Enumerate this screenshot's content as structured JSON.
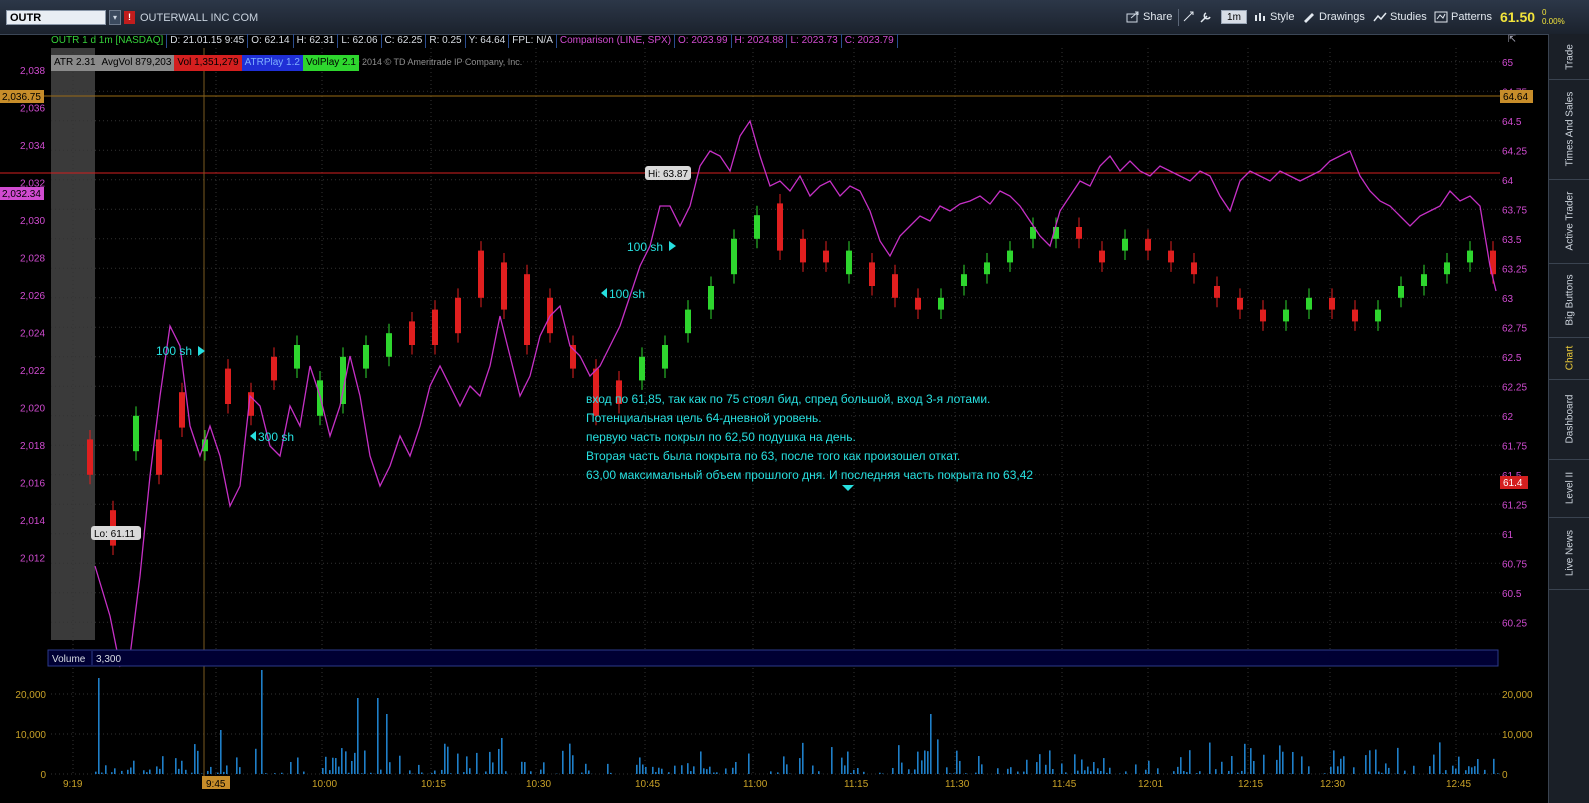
{
  "header": {
    "symbol": "OUTR",
    "company": "OUTERWALL INC COM",
    "flag": "!",
    "toolbar": [
      {
        "label": "Share",
        "icon": "share-icon"
      },
      {
        "label": "Style",
        "icon": "style-icon"
      },
      {
        "label": "Drawings",
        "icon": "drawings-icon"
      },
      {
        "label": "Studies",
        "icon": "studies-icon"
      },
      {
        "label": "Patterns",
        "icon": "patterns-icon"
      }
    ],
    "period": "1m",
    "last_price": "61.50",
    "change_top": "0",
    "change_bottom": "0.00%"
  },
  "infobar": {
    "symbol_desc": "OUTR 1 d 1m [NASDAQ]",
    "date": "D: 21.01.15 9:45",
    "open": "O: 62.14",
    "high": "H: 62.31",
    "low": "L: 62.06",
    "close": "C: 62.25",
    "range": "R: 0.25",
    "y": "Y: 64.64",
    "fpl": "FPL: N/A",
    "comparison": "Comparison (LINE, SPX)",
    "cmp_open": "O: 2023.99",
    "cmp_high": "H: 2024.88",
    "cmp_low": "L: 2023.73",
    "cmp_close": "C: 2023.79"
  },
  "studies": [
    {
      "label": "ATR 2.31",
      "bg": "#8a8a8a",
      "fg": "#000000"
    },
    {
      "label": "AvgVol 879,203",
      "bg": "#8a8a8a",
      "fg": "#000000"
    },
    {
      "label": "Vol 1,351,279",
      "bg": "#d41f1f",
      "fg": "#000000"
    },
    {
      "label": "ATRPlay 1.2",
      "bg": "#1f2fd6",
      "fg": "#7fb0ff"
    },
    {
      "label": "VolPlay 2.1",
      "bg": "#2ed62e",
      "fg": "#000000"
    }
  ],
  "copyright": "2014 © TD Ameritrade IP Company, Inc.",
  "price_axis_right": [
    "65",
    "64.75",
    "64.5",
    "64.25",
    "64",
    "63.75",
    "63.5",
    "63.25",
    "63",
    "62.75",
    "62.5",
    "62.25",
    "62",
    "61.75",
    "61.5",
    "61.25",
    "61",
    "60.75",
    "60.5",
    "60.25"
  ],
  "price_axis_left": [
    "2,038",
    "2,036",
    "2,034",
    "2,032",
    "2,030",
    "2,028",
    "2,026",
    "2,024",
    "2,022",
    "2,020",
    "2,018",
    "2,016",
    "2,014",
    "2,012"
  ],
  "time_axis": [
    "9:19",
    "9:45",
    "10:00",
    "10:15",
    "10:30",
    "10:45",
    "11:00",
    "11:15",
    "11:30",
    "11:45",
    "12:01",
    "12:15",
    "12:30",
    "12:45"
  ],
  "volume_axis": [
    "20,000",
    "10,000",
    "0"
  ],
  "markers": {
    "left_price_1": "2,036.75",
    "left_price_2": "2,032.34",
    "right_price_1": "64.64",
    "right_price_2": "61.4",
    "hi_label": "Hi: 63.87",
    "lo_label": "Lo: 61.11"
  },
  "trade_labels": [
    "100 sh",
    "300 sh",
    "100 sh",
    "100 sh"
  ],
  "volume_pane": {
    "label": "Volume",
    "value": "3,300"
  },
  "annotation": [
    "вход по 61,85, так как по 75 стоял бид, спред большой, вход 3-я лотами.",
    "Потенциальная цель 64-дневной уровень.",
    "первую часть покрыл по 62,50 подушка на день.",
    "Вторая часть была покрыта по 63, после того как произошел откат.",
    "63,00 максимальный объем прошлого дня. И последняя часть покрыта по 63,42"
  ],
  "side_tabs": [
    "Trade",
    "Times And Sales",
    "Active Trader",
    "Big Buttons",
    "Chart",
    "Dashboard",
    "Level II",
    "Live News"
  ],
  "active_side_tab": "Chart",
  "chart_data": {
    "type": "candlestick",
    "y_range": [
      60.1,
      65.1
    ],
    "x_range_minutes": "9:19-12:52",
    "candles": [
      [
        61.8,
        61.5
      ],
      [
        61.2,
        60.9
      ],
      [
        61.7,
        62.0
      ],
      [
        61.8,
        61.5
      ],
      [
        62.2,
        61.9
      ],
      [
        61.7,
        61.8
      ],
      [
        62.4,
        62.1
      ],
      [
        62.2,
        62.0
      ],
      [
        62.5,
        62.3
      ],
      [
        62.4,
        62.6
      ],
      [
        62.0,
        62.3
      ],
      [
        62.1,
        62.5
      ],
      [
        62.4,
        62.6
      ],
      [
        62.5,
        62.7
      ],
      [
        62.8,
        62.6
      ],
      [
        62.9,
        62.6
      ],
      [
        63.0,
        62.7
      ],
      [
        63.4,
        63.0
      ],
      [
        63.3,
        62.9
      ],
      [
        63.2,
        62.6
      ],
      [
        63.0,
        62.7
      ],
      [
        62.6,
        62.4
      ],
      [
        62.4,
        62.0
      ],
      [
        62.3,
        62.1
      ],
      [
        62.3,
        62.5
      ],
      [
        62.4,
        62.6
      ],
      [
        62.7,
        62.9
      ],
      [
        62.9,
        63.1
      ],
      [
        63.2,
        63.5
      ],
      [
        63.5,
        63.7
      ],
      [
        63.8,
        63.4
      ],
      [
        63.5,
        63.3
      ],
      [
        63.4,
        63.3
      ],
      [
        63.2,
        63.4
      ],
      [
        63.3,
        63.1
      ],
      [
        63.2,
        63.0
      ],
      [
        63.0,
        62.9
      ],
      [
        62.9,
        63.0
      ],
      [
        63.1,
        63.2
      ],
      [
        63.2,
        63.3
      ],
      [
        63.3,
        63.4
      ],
      [
        63.5,
        63.6
      ],
      [
        63.5,
        63.6
      ],
      [
        63.6,
        63.5
      ],
      [
        63.4,
        63.3
      ],
      [
        63.4,
        63.5
      ],
      [
        63.5,
        63.4
      ],
      [
        63.4,
        63.3
      ],
      [
        63.3,
        63.2
      ],
      [
        63.1,
        63.0
      ],
      [
        63.0,
        62.9
      ],
      [
        62.9,
        62.8
      ],
      [
        62.8,
        62.9
      ],
      [
        62.9,
        63.0
      ],
      [
        63.0,
        62.9
      ],
      [
        62.9,
        62.8
      ],
      [
        62.8,
        62.9
      ],
      [
        63.0,
        63.1
      ],
      [
        63.1,
        63.2
      ],
      [
        63.2,
        63.3
      ],
      [
        63.3,
        63.4
      ],
      [
        63.4,
        63.2
      ]
    ],
    "volume_max": 26000,
    "comparison_series": "SPX"
  }
}
